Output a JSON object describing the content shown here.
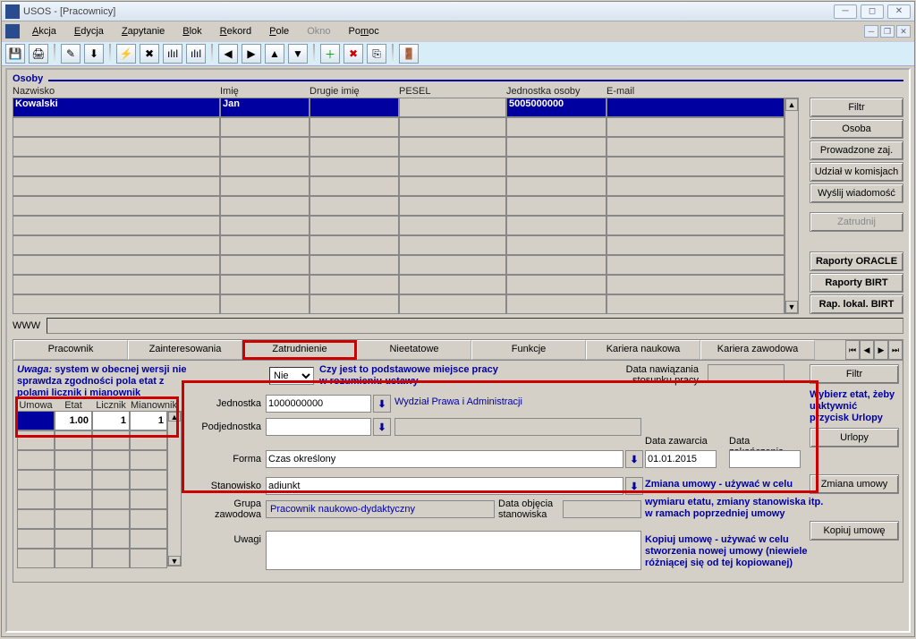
{
  "window": {
    "title": "USOS - [Pracownicy]"
  },
  "menu": {
    "akcja": "Akcja",
    "edycja": "Edycja",
    "zapytanie": "Zapytanie",
    "blok": "Blok",
    "rekord": "Rekord",
    "pole": "Pole",
    "okno": "Okno",
    "pomoc": "Pomoc"
  },
  "section": {
    "title": "Osoby"
  },
  "headers": {
    "nazwisko": "Nazwisko",
    "imie": "Imię",
    "drugie": "Drugie imię",
    "pesel": "PESEL",
    "jednostka_os": "Jednostka osoby",
    "email": "E-mail"
  },
  "data_row": {
    "nazwisko": "Kowalski",
    "imie": "Jan",
    "drugie": "",
    "pesel": "",
    "jednostka_os": "5005000000",
    "email": ""
  },
  "www": {
    "label": "WWW"
  },
  "side": {
    "filtr": "Filtr",
    "osoba": "Osoba",
    "prowadzone": "Prowadzone zaj.",
    "komisje": "Udział w komisjach",
    "wiadomosc": "Wyślij wiadomość",
    "zatrudnij": "Zatrudnij",
    "rap_oracle": "Raporty ORACLE",
    "rap_birt": "Raporty BIRT",
    "rap_lokal": "Rap. lokal. BIRT"
  },
  "tabs": {
    "pracownik": "Pracownik",
    "zainter": "Zainteresowania",
    "zatrudnienie": "Zatrudnienie",
    "nieetatowe": "Nieetatowe",
    "funkcje": "Funkcje",
    "kariera_n": "Kariera naukowa",
    "kariera_z": "Kariera zawodowa"
  },
  "notes": {
    "uwaga": "Uwaga: system w obecnej wersji nie sprawdza zgodności pola etat z polami licznik i mianownik",
    "czy_podst": "Czy jest to podstawowe miejsce pracy w rozumieniu ustawy",
    "data_naw": "Data nawiązania stosunku pracy",
    "zmiana_hint": "Zmiana umowy - używać w celu",
    "zmiana_hint2": "wymiaru etatu, zmiany stanowiska itp. w ramach poprzedniej umowy",
    "kopiuj_hint": "Kopiuj umowę - używać w celu stworzenia nowej umowy (niewiele różniącej się od tej kopiowanej)",
    "wybierz_etat": "Wybierz etat, żeby uaktywnić przycisk Urlopy"
  },
  "mini_headers": {
    "umowa": "Umowa",
    "etat": "Etat",
    "licznik": "Licznik",
    "mian": "Mianownik"
  },
  "mini_row": {
    "umowa": "",
    "etat": "1.00",
    "licznik": "1",
    "mian": "1"
  },
  "labels": {
    "jednostka": "Jednostka",
    "podjednostka": "Podjednostka",
    "forma": "Forma",
    "stanowisko": "Stanowisko",
    "grupa": "Grupa zawodowa",
    "uwagi": "Uwagi",
    "data_zaw": "Data zawarcia",
    "data_zak": "Data zakończenia",
    "data_obj": "Data objęcia stanowiska"
  },
  "fields": {
    "nie": "Nie",
    "jednostka_val": "1000000000",
    "jednostka_name": "Wydział Prawa i Administracji",
    "podjednostka_val": "",
    "forma": "Czas określony",
    "stanowisko": "adiunkt",
    "grupa_zaw": "Pracownik naukowo-dydaktyczny",
    "data_zaw": "01.01.2015",
    "data_zak": ""
  },
  "buttons": {
    "filtr2": "Filtr",
    "urlopy": "Urlopy",
    "zmiana": "Zmiana umowy",
    "kopiuj": "Kopiuj umowę"
  }
}
